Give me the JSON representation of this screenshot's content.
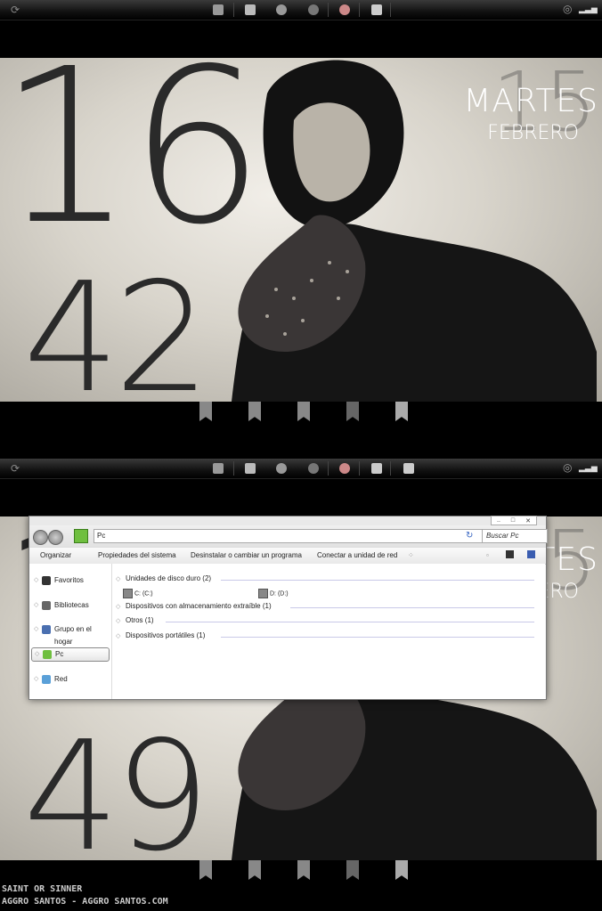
{
  "top": {
    "wallpaper": {
      "hour": "16",
      "minute": "42",
      "weekday": "MARTES",
      "month": "FEBRERO",
      "date": "15"
    }
  },
  "bottom": {
    "wallpaper": {
      "hour": "16",
      "minute": "49",
      "weekday": "MARTES",
      "month": "FEBRERO",
      "date": "15"
    },
    "explorer": {
      "address": "Pc",
      "search_placeholder": "Buscar Pc",
      "window_controls": [
        "..",
        "□",
        "✕"
      ],
      "toolbar": [
        "Organizar",
        "Propiedades del sistema",
        "Desinstalar o cambiar un programa",
        "Conectar a unidad de red"
      ],
      "sidebar": [
        "Favoritos",
        "Bibliotecas",
        "Grupo en el hogar",
        "Pc",
        "Red"
      ],
      "groups": [
        "Unidades de disco duro (2)",
        "Dispositivos con almacenamiento extraíble (1)",
        "Otros (1)",
        "Dispositivos portátiles (1)"
      ],
      "drives": [
        "C: (C:)",
        "D: (D:)"
      ]
    }
  },
  "credits": {
    "line1": "SAINT OR SINNER",
    "line2": "AGGRO SANTOS - AGGRO SANTOS.COM"
  },
  "colors": {
    "wallpaper_light": "#f1eee8",
    "wallpaper_dark": "#2a2a2a",
    "accent_blue": "#3060c0",
    "address_icon": "#6fbf3f"
  },
  "icons": {
    "taskbar": [
      "refresh-icon",
      "photo-icon",
      "calendar-icon",
      "users-icon",
      "music-icon",
      "chrome-icon",
      "media-icon",
      "folder-icon",
      "power-icon",
      "signal-icon"
    ],
    "dock": [
      "search-tab-icon",
      "music-tab-icon",
      "doc-tab-icon",
      "book-tab-icon",
      "bookmark-tab-icon"
    ]
  }
}
